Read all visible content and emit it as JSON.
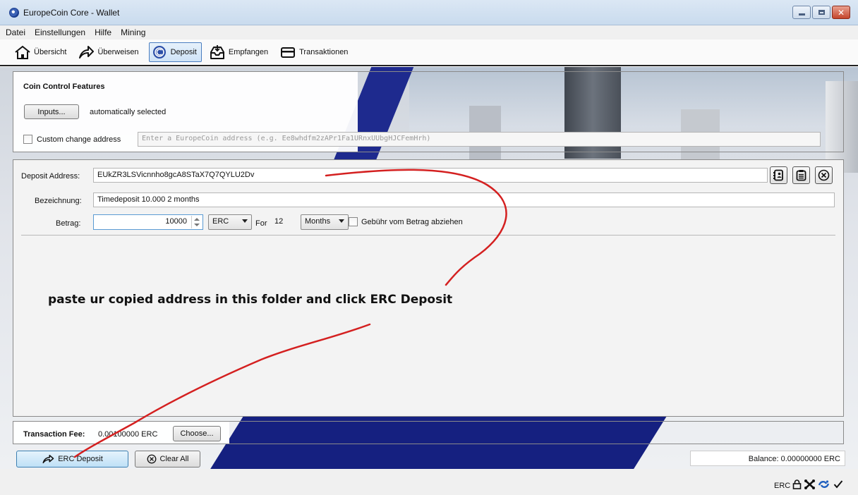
{
  "window": {
    "title": "EuropeCoin Core - Wallet"
  },
  "menu": [
    "Datei",
    "Einstellungen",
    "Hilfe",
    "Mining"
  ],
  "toolbar": [
    {
      "label": "Übersicht",
      "icon": "home-icon"
    },
    {
      "label": "Überweisen",
      "icon": "send-arrow-icon"
    },
    {
      "label": "Deposit",
      "icon": "coin-icon",
      "active": true
    },
    {
      "label": "Empfangen",
      "icon": "inbox-icon"
    },
    {
      "label": "Transaktionen",
      "icon": "card-icon"
    }
  ],
  "coin_control": {
    "title": "Coin Control Features",
    "inputs_button": "Inputs...",
    "inputs_status": "automatically selected",
    "custom_change_label": "Custom change address",
    "custom_change_placeholder": "Enter a EuropeCoin address (e.g. Ee8whdfm2zAPr1Fa1URnxUUbgHJCFemHrh)"
  },
  "deposit": {
    "address_label": "Deposit Address:",
    "address_value": "EUkZR3LSVicnnho8gcA8STaX7Q7QYLU2Dv",
    "label_label": "Bezeichnung:",
    "label_value": "Timedeposit 10.000 2 months",
    "amount_label": "Betrag:",
    "amount_value": "10000",
    "unit": "ERC",
    "for_label": "For",
    "for_value": "12",
    "period": "Months",
    "subtract_fee_label": "Gebühr vom Betrag abziehen"
  },
  "annotation": "paste ur copied address in this folder and click ERC Deposit",
  "fee": {
    "label": "Transaction Fee:",
    "value": "0.00100000 ERC",
    "choose_button": "Choose..."
  },
  "actions": {
    "deposit_button": "ERC Deposit",
    "clear_button": "Clear All"
  },
  "balance": "Balance: 0.00000000 ERC",
  "status": {
    "unit": "ERC"
  },
  "colors": {
    "annotation_line": "#d42020",
    "accent_blue": "#1e2a8e"
  }
}
